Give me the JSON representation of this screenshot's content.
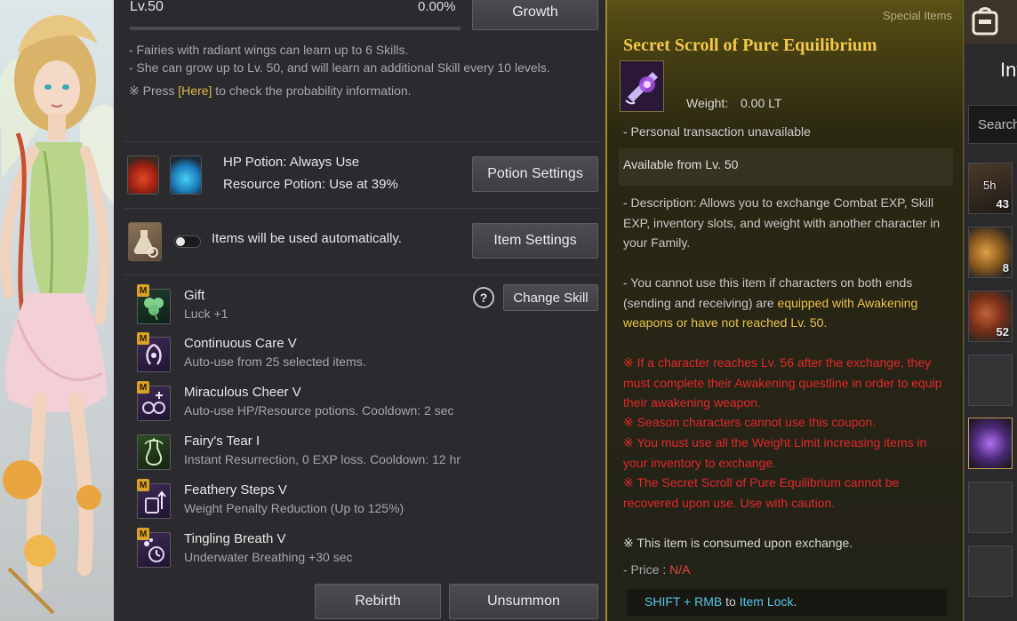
{
  "fairy": {
    "level": "Lv.50",
    "exp_percent": "0.00%",
    "exp_fraction": 0.0,
    "growth_button": "Growth",
    "desc_line1": "- Fairies with radiant wings can learn up to 6 Skills.",
    "desc_line2": "- She can grow up to Lv. 50, and will learn an additional Skill every 10 levels.",
    "desc_line3_prefix": "※ Press ",
    "desc_line3_link": "[Here]",
    "desc_line3_suffix": " to check the probability information.",
    "hp_potion": "HP Potion: Always Use",
    "resource_potion": "Resource Potion: Use at 39%",
    "potion_settings_button": "Potion Settings",
    "auto_items_text": "Items will be used automatically.",
    "item_settings_button": "Item Settings",
    "help_label": "?",
    "change_skill_button": "Change Skill",
    "skills": [
      {
        "name": "Gift",
        "desc": "Luck +1",
        "badge": "M"
      },
      {
        "name": "Continuous Care V",
        "desc": "Auto-use from 25 selected items.",
        "badge": "M"
      },
      {
        "name": "Miraculous Cheer V",
        "desc": "Auto-use HP/Resource potions. Cooldown: 2 sec",
        "badge": "M"
      },
      {
        "name": "Fairy's Tear I",
        "desc": "Instant Resurrection, 0 EXP loss. Cooldown: 12 hr",
        "badge": ""
      },
      {
        "name": "Feathery Steps V",
        "desc": "Weight Penalty Reduction (Up to 125%)",
        "badge": "M"
      },
      {
        "name": "Tingling Breath V",
        "desc": "Underwater Breathing +30 sec",
        "badge": "M"
      }
    ],
    "rebirth_button": "Rebirth",
    "unsummon_button": "Unsummon"
  },
  "tooltip": {
    "category": "Special Items",
    "title": "Secret Scroll of Pure Equilibrium",
    "weight_label": "Weight:",
    "weight_value": "0.00 LT",
    "transaction": "- Personal transaction unavailable",
    "available": "Available from Lv. 50",
    "description": "- Description: Allows you to exchange Combat EXP, Skill EXP, inventory slots, and weight with another character in your Family.",
    "restriction_prefix": "- You cannot use this item if characters on both ends (sending and receiving) are ",
    "restriction_highlight": "equipped with Awakening weapons or have not reached Lv. 50.",
    "warning1": "※ If a character reaches Lv. 56 after the exchange, they must complete their Awakening questline in order to equip their awakening weapon.",
    "warning2": "※ Season characters cannot use this coupon.",
    "warning3": "※ You must use all the Weight Limit increasing items in your inventory to exchange.",
    "warning4": "※ The Secret Scroll of Pure Equilibrium cannot be recovered upon use. Use with caution.",
    "consumed": "※ This item is consumed upon exchange.",
    "price_label": "- Price : ",
    "price_value": "N/A",
    "footer_key": "SHIFT + RMB",
    "footer_mid": " to ",
    "footer_action": "Item Lock",
    "footer_end": "."
  },
  "inventory": {
    "tab_label": "Inv",
    "search_placeholder": "Search",
    "slots": [
      {
        "timer": "5h",
        "count": "43"
      },
      {
        "timer": "",
        "count": "8"
      },
      {
        "timer": "",
        "count": "52"
      },
      {
        "timer": "",
        "count": ""
      },
      {
        "timer": "",
        "count": ""
      },
      {
        "timer": "",
        "count": ""
      },
      {
        "timer": "",
        "count": ""
      }
    ]
  },
  "colors": {
    "accent_gold": "#f5c84a",
    "warning_red": "#e4282a",
    "link_cyan": "#56c7e8",
    "panel_bg": "#2b2b2f"
  }
}
